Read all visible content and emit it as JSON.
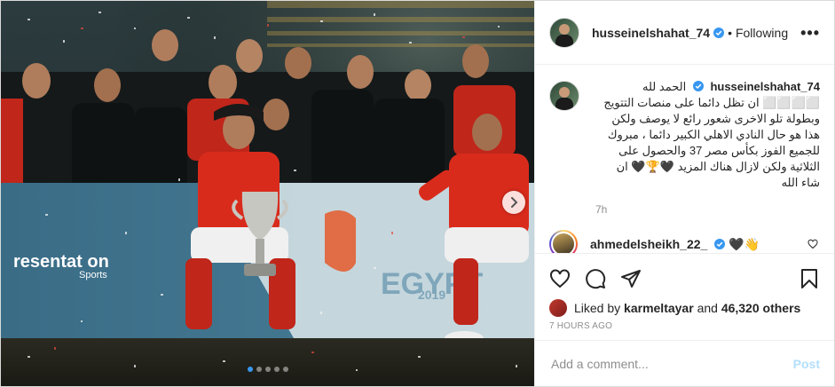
{
  "colors": {
    "accent_blue": "#3897f0",
    "post_button_disabled": "#b2dffc",
    "text_primary": "#262626",
    "text_secondary": "#8e8e8e",
    "kit_red": "#d92b1c"
  },
  "media": {
    "banner_left_text": "resentat on",
    "banner_sponsor": "Sports",
    "banner_right_text": "EGYPT",
    "banner_year": "2019",
    "carousel_dots": 5,
    "active_dot": 0,
    "next_icon": "chevron-right-icon"
  },
  "header": {
    "username": "husseinelshahat_74",
    "separator": "•",
    "follow_status": "Following",
    "more_icon": "more-horizontal-icon"
  },
  "caption": {
    "username": "husseinelshahat_74",
    "text": "الحمد لله ⬜⬜⬜⬜ ان تظل دائما على منصات التتويج وبطولة تلو الاخرى شعور رائع لا يوصف ولكن هذا هو حال النادي الاهلي الكبير دائما ، مبروك للجميع الفوز بكأس مصر 37 والحصول على الثلاثية ولكن لازال هناك المزيد 🖤🏆🖤 ان شاء الله",
    "time": "7h"
  },
  "comments": [
    {
      "username": "ahmedelsheikh_22_",
      "text": "🖤👋"
    }
  ],
  "actions": {
    "like_icon": "heart-icon",
    "comment_icon": "comment-icon",
    "share_icon": "share-icon",
    "save_icon": "bookmark-icon"
  },
  "likes": {
    "prefix": "Liked by",
    "user": "karmeltayar",
    "middle": "and",
    "others": "46,320 others"
  },
  "timestamp": "7 HOURS AGO",
  "add_comment": {
    "placeholder": "Add a comment...",
    "post_label": "Post"
  }
}
